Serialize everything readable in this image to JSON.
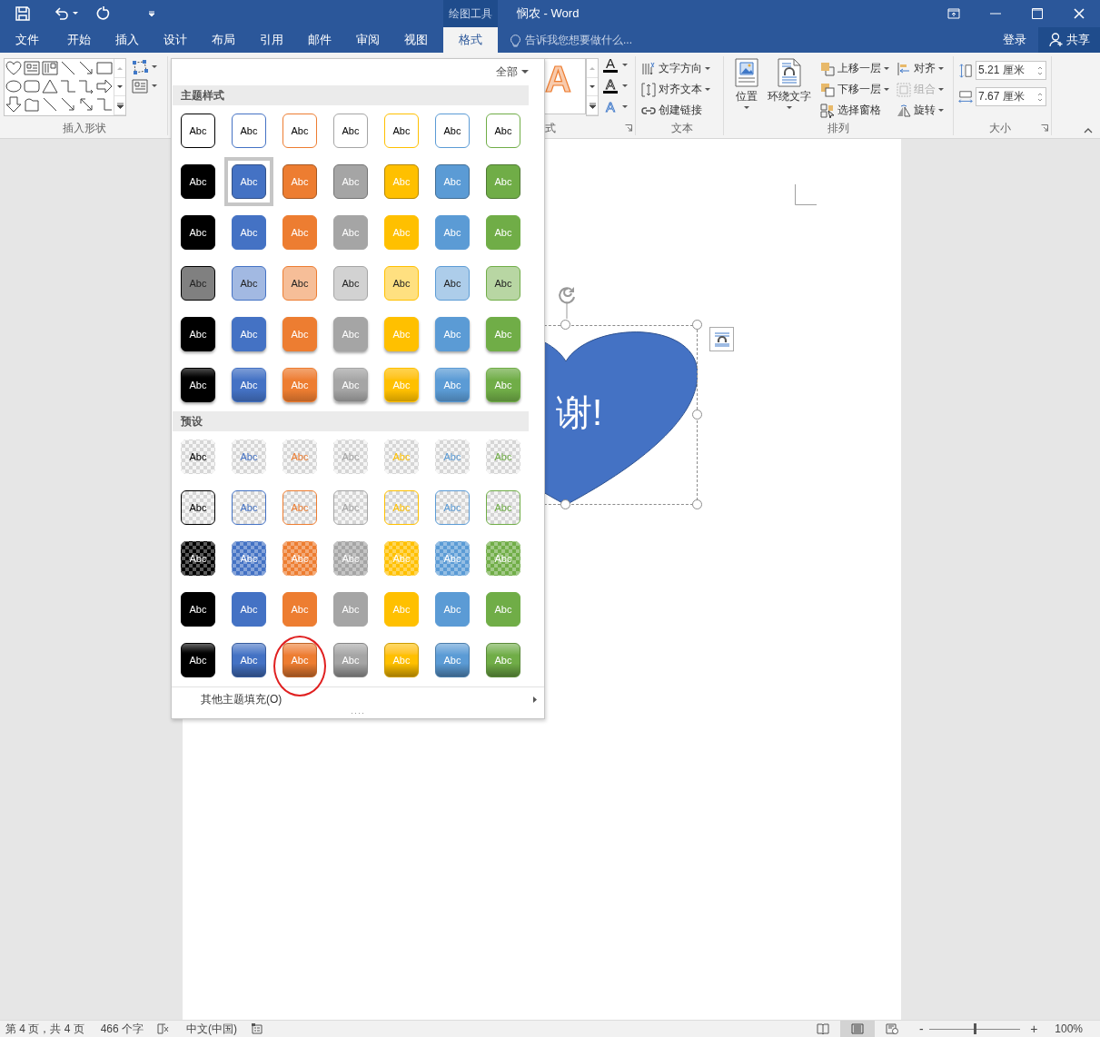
{
  "title_bar": {
    "context_tab": "绘图工具",
    "title": "悯农 - Word"
  },
  "tabs": [
    {
      "label": "文件",
      "selected": false
    },
    {
      "label": "开始",
      "selected": false
    },
    {
      "label": "插入",
      "selected": false
    },
    {
      "label": "设计",
      "selected": false
    },
    {
      "label": "布局",
      "selected": false
    },
    {
      "label": "引用",
      "selected": false
    },
    {
      "label": "邮件",
      "selected": false
    },
    {
      "label": "审阅",
      "selected": false
    },
    {
      "label": "视图",
      "selected": false
    },
    {
      "label": "格式",
      "selected": true
    }
  ],
  "tell_me": {
    "placeholder": "告诉我您想要做什么..."
  },
  "account": {
    "sign_in": "登录",
    "share": "共享"
  },
  "ribbon": {
    "insert_shapes": {
      "label": "插入形状"
    },
    "wordart": {
      "preview": "A",
      "label": "式",
      "tools": [
        {
          "kind": "fill",
          "glyph": "A"
        },
        {
          "kind": "outline",
          "glyph": "A"
        },
        {
          "kind": "effects",
          "glyph": "A"
        }
      ]
    },
    "text": {
      "label": "文本",
      "items": [
        {
          "kind": "direction",
          "label": "文字方向",
          "dropdown": true
        },
        {
          "kind": "align",
          "label": "对齐文本",
          "dropdown": true
        },
        {
          "kind": "link",
          "label": "创建链接",
          "dropdown": false
        }
      ]
    },
    "arrange": {
      "label": "排列",
      "large": [
        {
          "kind": "position",
          "label": "位置"
        },
        {
          "kind": "wrap",
          "label": "环绕文字"
        }
      ],
      "columns": [
        [
          {
            "kind": "forward",
            "label": "上移一层",
            "disabled": false
          },
          {
            "kind": "backward",
            "label": "下移一层",
            "disabled": false
          },
          {
            "kind": "pane",
            "label": "选择窗格",
            "disabled": false
          }
        ],
        [
          {
            "kind": "align",
            "label": "对齐",
            "disabled": false
          },
          {
            "kind": "group",
            "label": "组合",
            "disabled": true
          },
          {
            "kind": "rotate",
            "label": "旋转",
            "disabled": false
          }
        ]
      ]
    },
    "size": {
      "label": "大小",
      "fields": [
        {
          "kind": "height",
          "value": "5.21 厘米"
        },
        {
          "kind": "width",
          "value": "7.67 厘米"
        }
      ]
    }
  },
  "gallery": {
    "filter": "全部",
    "footer": "其他主题填充(O)",
    "sections": [
      {
        "title": "主题样式",
        "rows": [
          {
            "kind": "outline",
            "items": [
              {
                "label": "Abc",
                "color": "#000000",
                "selected": false,
                "circled": false
              },
              {
                "label": "Abc",
                "color": "#4472c4",
                "selected": false,
                "circled": false
              },
              {
                "label": "Abc",
                "color": "#ed7d31",
                "selected": false,
                "circled": false
              },
              {
                "label": "Abc",
                "color": "#a5a5a5",
                "selected": false,
                "circled": false
              },
              {
                "label": "Abc",
                "color": "#ffc000",
                "selected": false,
                "circled": false
              },
              {
                "label": "Abc",
                "color": "#5b9bd5",
                "selected": false,
                "circled": false
              },
              {
                "label": "Abc",
                "color": "#70ad47",
                "selected": false,
                "circled": false
              }
            ]
          },
          {
            "kind": "bordered",
            "items": [
              {
                "label": "Abc",
                "color": "#000000",
                "selected": false,
                "circled": false
              },
              {
                "label": "Abc",
                "color": "#4472c4",
                "selected": true,
                "circled": false
              },
              {
                "label": "Abc",
                "color": "#ed7d31",
                "selected": false,
                "circled": false
              },
              {
                "label": "Abc",
                "color": "#a5a5a5",
                "selected": false,
                "circled": false
              },
              {
                "label": "Abc",
                "color": "#ffc000",
                "selected": false,
                "circled": false
              },
              {
                "label": "Abc",
                "color": "#5b9bd5",
                "selected": false,
                "circled": false
              },
              {
                "label": "Abc",
                "color": "#70ad47",
                "selected": false,
                "circled": false
              }
            ]
          },
          {
            "kind": "flat",
            "items": [
              {
                "label": "Abc",
                "color": "#000000",
                "selected": false,
                "circled": false
              },
              {
                "label": "Abc",
                "color": "#4472c4",
                "selected": false,
                "circled": false
              },
              {
                "label": "Abc",
                "color": "#ed7d31",
                "selected": false,
                "circled": false
              },
              {
                "label": "Abc",
                "color": "#a5a5a5",
                "selected": false,
                "circled": false
              },
              {
                "label": "Abc",
                "color": "#ffc000",
                "selected": false,
                "circled": false
              },
              {
                "label": "Abc",
                "color": "#5b9bd5",
                "selected": false,
                "circled": false
              },
              {
                "label": "Abc",
                "color": "#70ad47",
                "selected": false,
                "circled": false
              }
            ]
          },
          {
            "kind": "light",
            "items": [
              {
                "label": "Abc",
                "color": "#000000",
                "selected": false,
                "circled": false
              },
              {
                "label": "Abc",
                "color": "#4472c4",
                "selected": false,
                "circled": false
              },
              {
                "label": "Abc",
                "color": "#ed7d31",
                "selected": false,
                "circled": false
              },
              {
                "label": "Abc",
                "color": "#a5a5a5",
                "selected": false,
                "circled": false
              },
              {
                "label": "Abc",
                "color": "#ffc000",
                "selected": false,
                "circled": false
              },
              {
                "label": "Abc",
                "color": "#5b9bd5",
                "selected": false,
                "circled": false
              },
              {
                "label": "Abc",
                "color": "#70ad47",
                "selected": false,
                "circled": false
              }
            ]
          },
          {
            "kind": "raised",
            "items": [
              {
                "label": "Abc",
                "color": "#000000",
                "selected": false,
                "circled": false
              },
              {
                "label": "Abc",
                "color": "#4472c4",
                "selected": false,
                "circled": false
              },
              {
                "label": "Abc",
                "color": "#ed7d31",
                "selected": false,
                "circled": false
              },
              {
                "label": "Abc",
                "color": "#a5a5a5",
                "selected": false,
                "circled": false
              },
              {
                "label": "Abc",
                "color": "#ffc000",
                "selected": false,
                "circled": false
              },
              {
                "label": "Abc",
                "color": "#5b9bd5",
                "selected": false,
                "circled": false
              },
              {
                "label": "Abc",
                "color": "#70ad47",
                "selected": false,
                "circled": false
              }
            ]
          },
          {
            "kind": "glossy",
            "items": [
              {
                "label": "Abc",
                "color": "#000000",
                "selected": false,
                "circled": false
              },
              {
                "label": "Abc",
                "color": "#4472c4",
                "selected": false,
                "circled": false
              },
              {
                "label": "Abc",
                "color": "#ed7d31",
                "selected": false,
                "circled": false
              },
              {
                "label": "Abc",
                "color": "#a5a5a5",
                "selected": false,
                "circled": false
              },
              {
                "label": "Abc",
                "color": "#ffc000",
                "selected": false,
                "circled": false
              },
              {
                "label": "Abc",
                "color": "#5b9bd5",
                "selected": false,
                "circled": false
              },
              {
                "label": "Abc",
                "color": "#70ad47",
                "selected": false,
                "circled": false
              }
            ]
          }
        ]
      },
      {
        "title": "预设",
        "rows": [
          {
            "kind": "clear",
            "items": [
              {
                "label": "Abc",
                "color": "#000000",
                "selected": false,
                "circled": false
              },
              {
                "label": "Abc",
                "color": "#4472c4",
                "selected": false,
                "circled": false
              },
              {
                "label": "Abc",
                "color": "#ed7d31",
                "selected": false,
                "circled": false
              },
              {
                "label": "Abc",
                "color": "#a5a5a5",
                "selected": false,
                "circled": false
              },
              {
                "label": "Abc",
                "color": "#ffc000",
                "selected": false,
                "circled": false
              },
              {
                "label": "Abc",
                "color": "#5b9bd5",
                "selected": false,
                "circled": false
              },
              {
                "label": "Abc",
                "color": "#70ad47",
                "selected": false,
                "circled": false
              }
            ]
          },
          {
            "kind": "clear-outline",
            "items": [
              {
                "label": "Abc",
                "color": "#000000",
                "selected": false,
                "circled": false
              },
              {
                "label": "Abc",
                "color": "#4472c4",
                "selected": false,
                "circled": false
              },
              {
                "label": "Abc",
                "color": "#ed7d31",
                "selected": false,
                "circled": false
              },
              {
                "label": "Abc",
                "color": "#a5a5a5",
                "selected": false,
                "circled": false
              },
              {
                "label": "Abc",
                "color": "#ffc000",
                "selected": false,
                "circled": false
              },
              {
                "label": "Abc",
                "color": "#5b9bd5",
                "selected": false,
                "circled": false
              },
              {
                "label": "Abc",
                "color": "#70ad47",
                "selected": false,
                "circled": false
              }
            ]
          },
          {
            "kind": "tint",
            "items": [
              {
                "label": "Abc",
                "color": "#000000",
                "selected": false,
                "circled": false
              },
              {
                "label": "Abc",
                "color": "#4472c4",
                "selected": false,
                "circled": false
              },
              {
                "label": "Abc",
                "color": "#ed7d31",
                "selected": false,
                "circled": false
              },
              {
                "label": "Abc",
                "color": "#a5a5a5",
                "selected": false,
                "circled": false
              },
              {
                "label": "Abc",
                "color": "#ffc000",
                "selected": false,
                "circled": false
              },
              {
                "label": "Abc",
                "color": "#5b9bd5",
                "selected": false,
                "circled": false
              },
              {
                "label": "Abc",
                "color": "#70ad47",
                "selected": false,
                "circled": false
              }
            ]
          },
          {
            "kind": "solid",
            "items": [
              {
                "label": "Abc",
                "color": "#000000",
                "selected": false,
                "circled": false
              },
              {
                "label": "Abc",
                "color": "#4472c4",
                "selected": false,
                "circled": false
              },
              {
                "label": "Abc",
                "color": "#ed7d31",
                "selected": false,
                "circled": false
              },
              {
                "label": "Abc",
                "color": "#a5a5a5",
                "selected": false,
                "circled": false
              },
              {
                "label": "Abc",
                "color": "#ffc000",
                "selected": false,
                "circled": false
              },
              {
                "label": "Abc",
                "color": "#5b9bd5",
                "selected": false,
                "circled": false
              },
              {
                "label": "Abc",
                "color": "#70ad47",
                "selected": false,
                "circled": false
              }
            ]
          },
          {
            "kind": "gradient",
            "items": [
              {
                "label": "Abc",
                "color": "#000000",
                "selected": false,
                "circled": false
              },
              {
                "label": "Abc",
                "color": "#4472c4",
                "selected": false,
                "circled": false
              },
              {
                "label": "Abc",
                "color": "#ed7d31",
                "selected": false,
                "circled": true
              },
              {
                "label": "Abc",
                "color": "#a5a5a5",
                "selected": false,
                "circled": false
              },
              {
                "label": "Abc",
                "color": "#ffc000",
                "selected": false,
                "circled": false
              },
              {
                "label": "Abc",
                "color": "#5b9bd5",
                "selected": false,
                "circled": false
              },
              {
                "label": "Abc",
                "color": "#70ad47",
                "selected": false,
                "circled": false
              }
            ]
          }
        ]
      }
    ]
  },
  "document": {
    "shape_text": "谢!"
  },
  "status_bar": {
    "page": "第 4 页，共 4 页",
    "words": "466 个字",
    "language": "中文(中国)",
    "views": [
      {
        "kind": "read",
        "selected": false
      },
      {
        "kind": "print",
        "selected": true
      },
      {
        "kind": "web",
        "selected": false
      }
    ],
    "zoom": {
      "minus": "-",
      "plus": "+",
      "level": 0.5,
      "value": "100%"
    }
  }
}
